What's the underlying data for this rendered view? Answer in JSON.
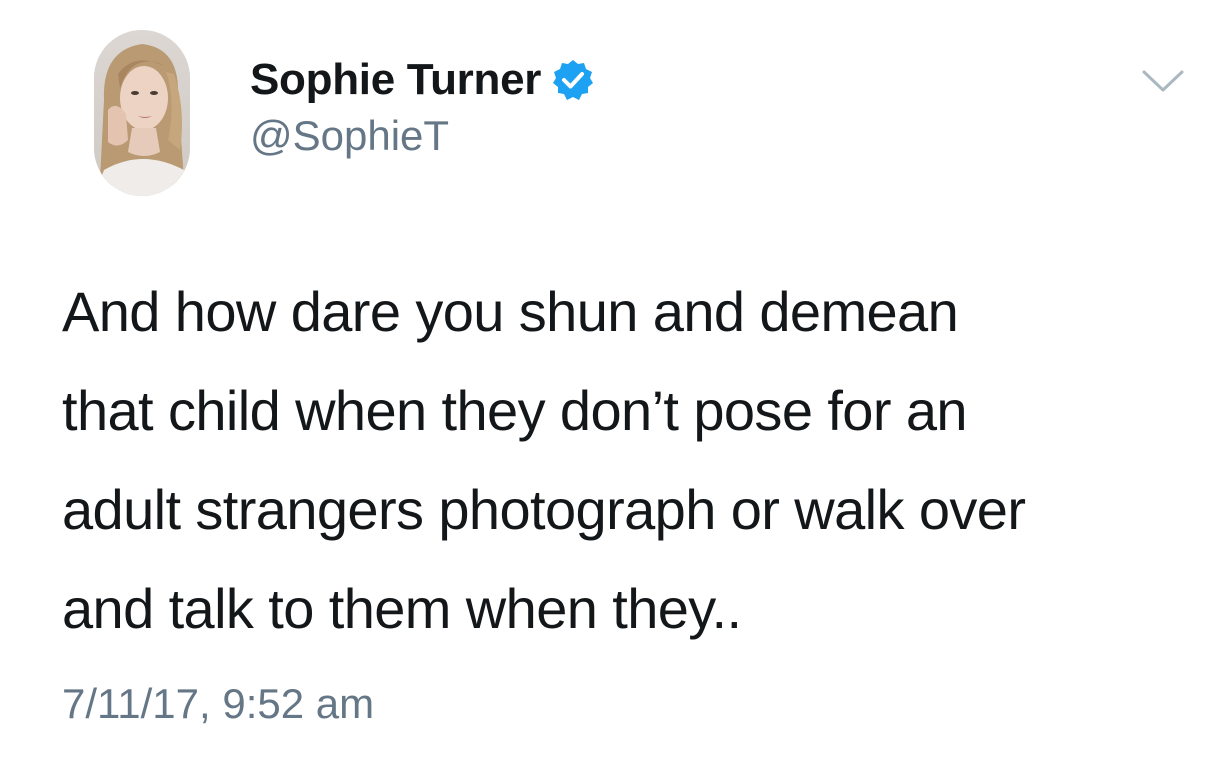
{
  "tweet": {
    "author": {
      "display_name": "Sophie Turner",
      "handle": "@SophieT",
      "verified": true
    },
    "text_lines": [
      "And how dare you shun and demean",
      "that child when they don’t pose for an",
      "adult strangers photograph or walk over",
      "and talk to them when they.."
    ],
    "timestamp": "7/11/17, 9:52 am"
  },
  "icons": {
    "verified": "verified-badge-icon",
    "more": "chevron-down-icon"
  },
  "colors": {
    "text_primary": "#14171a",
    "text_secondary": "#657786",
    "verified_blue": "#1da1f2",
    "background": "#ffffff"
  }
}
